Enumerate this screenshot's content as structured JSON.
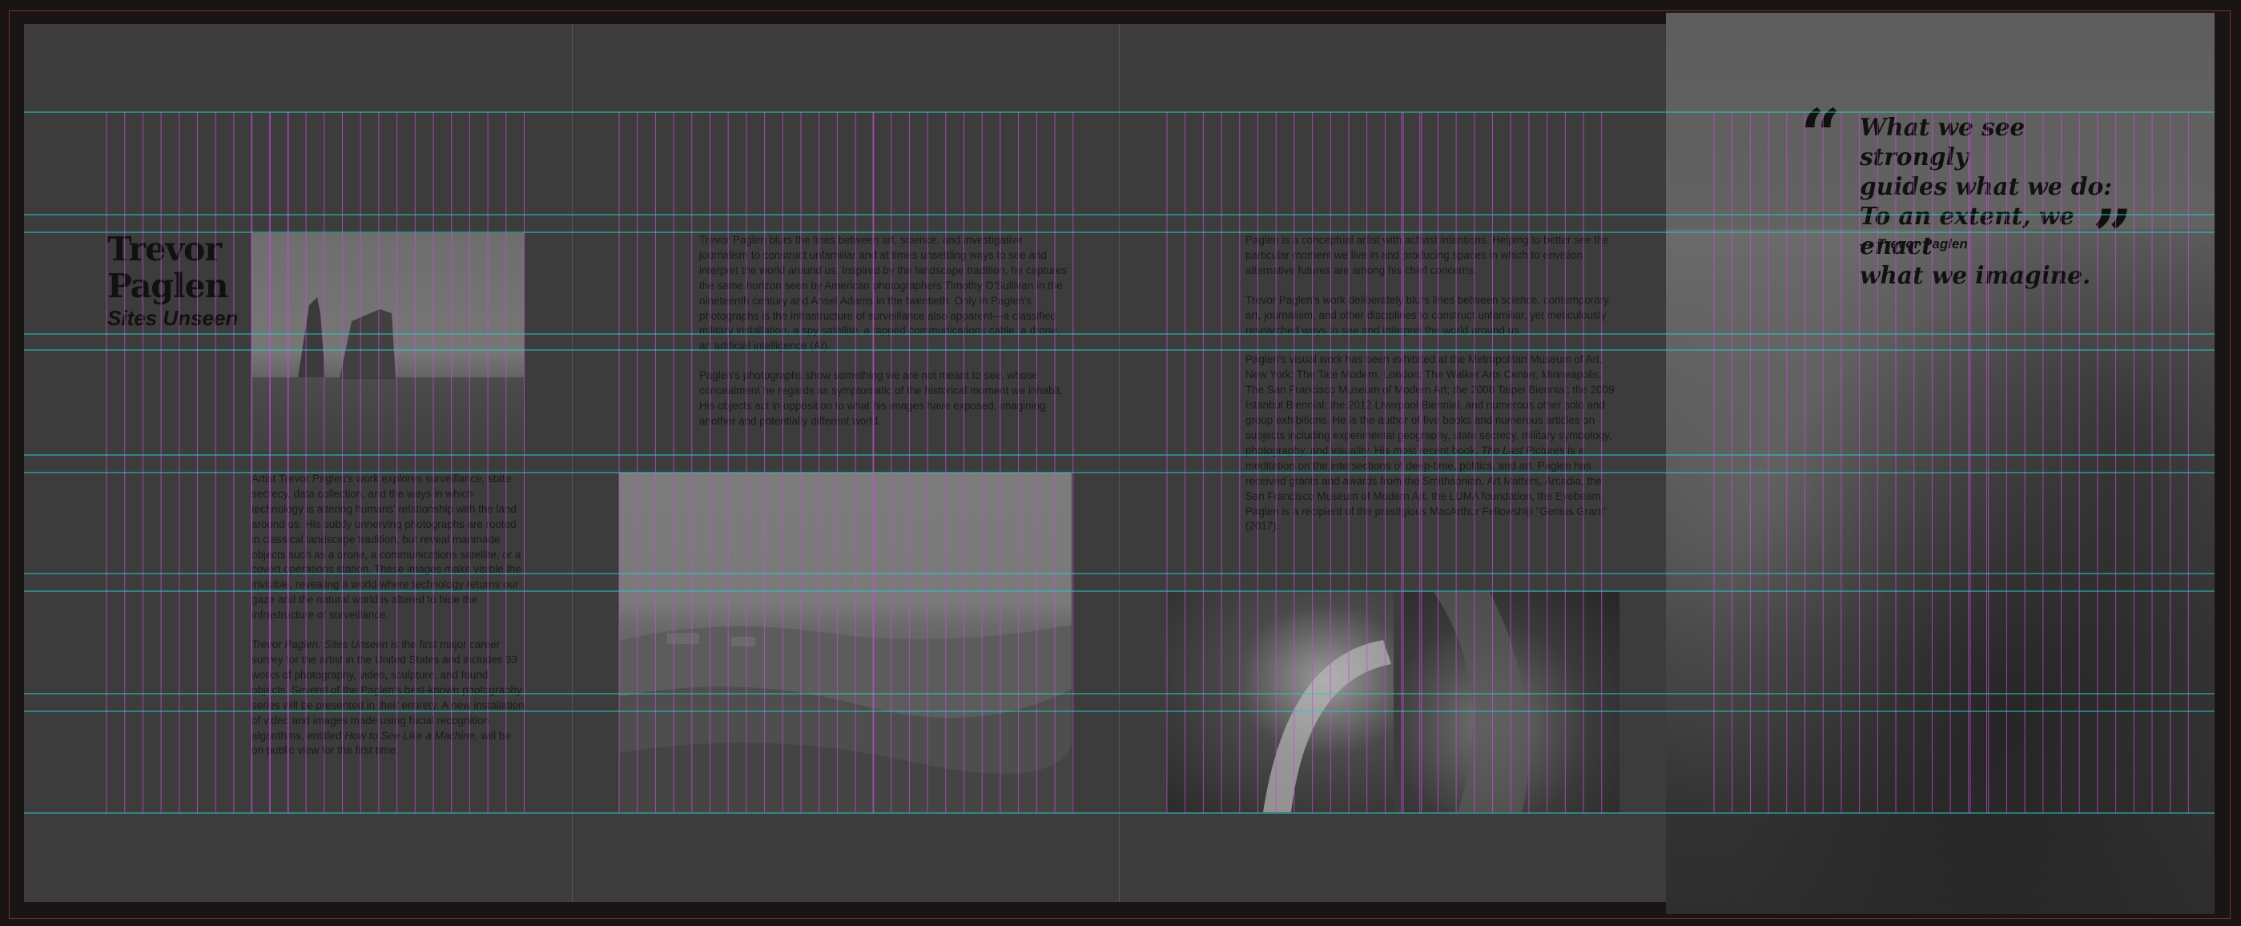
{
  "page": {
    "colors": {
      "background": "#1a1515",
      "spread": "#3c3c3c",
      "bleed": "#7a2e38",
      "margin_guide": "#c050d0",
      "baseline_guide": "#30c8c8",
      "ink": "#111111"
    }
  },
  "panel1": {
    "title_name": "Trevor\nPaglen",
    "title_sub": "Sites Unseen",
    "photo_icon": "sea-stacks-photo",
    "body": [
      "Artist Trevor Paglen's work explores surveillance, state secrecy, data collection, and the ways in which technology is altering humans' relationship with the land around us. His subtly unnerving photographs are rooted in classical landscape tradition, but reveal manmade objects such as a drone, a communications satellite, or a covert operations station. These images make visible the invisible, revealing a world where technology returns our gaze and the natural world is altered to hide the infrastructure of surveillance."
    ],
    "body_italic_lead": "Trevor Paglen: Sites Unseen",
    "body_after_italic": " is the first major career survey for the artist in the United States and includes 93 works of photography, video, sculpture, and found objects. Several of the Paglen's best-known photography series will be presented in their entirety. A new installation of video and images made using facial recognition algorithms, entitled ",
    "body_italic_2": "How to See Like a Machine,",
    "body_end": " will be on public view for the first time."
  },
  "panel2": {
    "body": [
      "Trevor Paglen blurs the lines between art, science, and investigative journalism to construct unfamiliar and at times unsettling ways to see and interpret the world around us. Inspired by the landscape tradition, he captures the same horizon seen by American photographers Timothy O'Sullivan in the nineteenth century and Ansel Adams in the twentieth. Only in Paglen's photographs is the infrastructure of surveillance also apparent—a classified military installation, a spy satellite, a tapped communications cable, a drone, an artificial intelligence (AI).",
      "Paglen's photographs show something we are not meant to see, whose concealment he regards as symptomatic of the historical moment we inhabit. His objects act in opposition to what his images have exposed, imagining another and potentially different world."
    ],
    "photo_icon": "rolling-hills-photo"
  },
  "panel3": {
    "body": [
      "Paglen is a conceptual artist with activist intentions. Helping to better see the particular moment we live in and producing spaces in which to envision alternative futures are among his chief concerns.",
      "Trevor Paglen's work deliberately blurs lines between science, contemporary art, journalism, and other disciplines to construct unfamiliar, yet meticulously researched ways to see and interpret the world around us."
    ],
    "body3_pre": "Paglen's visual work has been exhibited at the Metropolitan Museum of Art, New York; The Tate Modern, London; The Walker Arts Center, Minneapolis; The San Francisco Museum of Modern Art; the 2008 Taipei Biennial; the 2009 Istanbul Biennial; the 2012 Liverpool Biennial, and numerous other solo and group exhibitions. He is the author of five books and numerous articles on subjects including experimental geography, state secrecy, military symbology, photography, and visuality. His most recent book, ",
    "body3_italic": "The Last Pictures",
    "body3_post": " is a meditation on the intersections of deep-time, politics, and art. Paglen has received grants and awards from the Smithsonian, Art Matters, Arcadia, the San Francisco Museum of Modern Art, the LUMA foundation, the Eyebeam. Paglen is a recipient of the prestigious MacArthur Fellowship \"Genius Grant\" (2017).",
    "photo_left_icon": "light-arc-photo",
    "photo_right_icon": "dark-fabric-photo"
  },
  "panel4": {
    "quote": "What we see strongly\nguides what we do:\nTo an extent, we enact\nwhat we imagine.",
    "attribution": "— Trevor Paglen",
    "open_quote_icon": "open-quote-icon",
    "close_quote_icon": "close-quote-icon",
    "background_icon": "aerial-landscape-photo"
  }
}
